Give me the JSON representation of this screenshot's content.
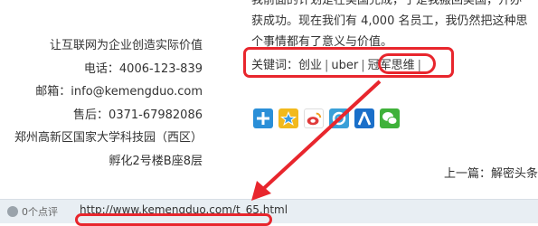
{
  "company": {
    "slogan": "让互联网为企业创造实际价值",
    "phone": "电话：4006-123-839",
    "email": "邮箱：info@kemengduo.com",
    "after_sales": "售后：0371-67982086",
    "address_line1": "郑州高新区国家大学科技园（西区）",
    "address_line2": "孵化2号楼B座8层"
  },
  "article": {
    "line1": "我前面的计划是在美国完成，于是我搬回美国，开办",
    "line2": "获成功。现在我们有 4,000 名员工，我仍然把这种思",
    "line3": "个事情都有了意义与价值。"
  },
  "keywords": {
    "label": "关键词：",
    "items": [
      "创业",
      "uber",
      "冠军思维"
    ]
  },
  "share": {
    "icons": [
      {
        "name": "more",
        "color": "#2a8fd8"
      },
      {
        "name": "qzone",
        "color": "#f2b91c"
      },
      {
        "name": "weibo",
        "color": "#e03a3a"
      },
      {
        "name": "tencent-weibo",
        "color": "#3aa0d8"
      },
      {
        "name": "renren",
        "color": "#1a6fc9"
      },
      {
        "name": "wechat",
        "color": "#3fb13a"
      }
    ]
  },
  "nav": {
    "prev": "上一篇：解密头条"
  },
  "footer": {
    "comments": "0个点评",
    "url": "http://www.kemengduo.com/t_65.html"
  },
  "colors": {
    "highlight": "#e8262d"
  }
}
